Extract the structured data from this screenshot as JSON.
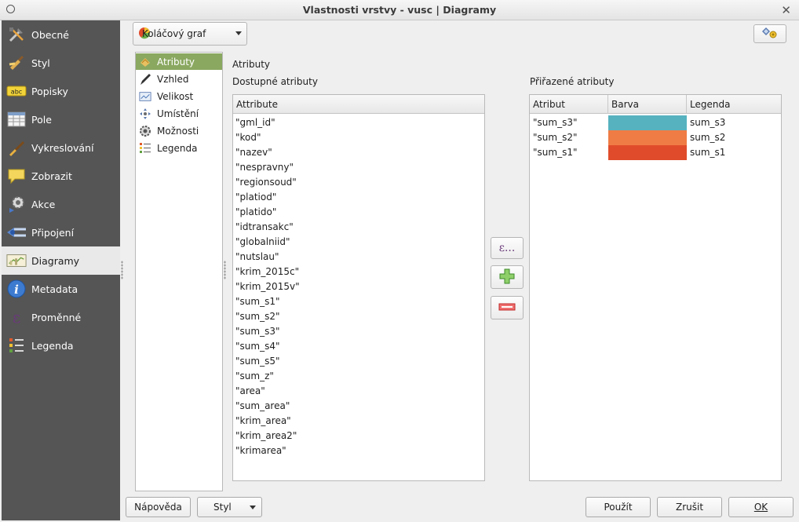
{
  "window": {
    "title": "Vlastnosti vrstvy - vusc | Diagramy"
  },
  "sidebar": {
    "items": [
      {
        "label": "Obecné",
        "icon": "tools-icon"
      },
      {
        "label": "Styl",
        "icon": "paintbrush-icon"
      },
      {
        "label": "Popisky",
        "icon": "abc-label-icon"
      },
      {
        "label": "Pole",
        "icon": "table-icon"
      },
      {
        "label": "Vykreslování",
        "icon": "brush-icon"
      },
      {
        "label": "Zobrazit",
        "icon": "speech-bubble-icon"
      },
      {
        "label": "Akce",
        "icon": "gear-action-icon"
      },
      {
        "label": "Připojení",
        "icon": "join-icon"
      },
      {
        "label": "Diagramy",
        "icon": "diagram-icon"
      },
      {
        "label": "Metadata",
        "icon": "info-icon"
      },
      {
        "label": "Proměnné",
        "icon": "epsilon-icon"
      },
      {
        "label": "Legenda",
        "icon": "legend-icon"
      }
    ],
    "active_index": 8
  },
  "diagram_type": {
    "selected": "Koláčový graf",
    "icon": "pie-chart-icon"
  },
  "subnav": {
    "items": [
      {
        "label": "Atributy",
        "icon": "attributes-icon"
      },
      {
        "label": "Vzhled",
        "icon": "pen-icon"
      },
      {
        "label": "Velikost",
        "icon": "size-icon"
      },
      {
        "label": "Umístění",
        "icon": "placement-icon"
      },
      {
        "label": "Možnosti",
        "icon": "options-icon"
      },
      {
        "label": "Legenda",
        "icon": "legend-icon"
      }
    ],
    "active_index": 0
  },
  "section": {
    "title": "Atributy",
    "available_label": "Dostupné atributy",
    "assigned_label": "Přiřazené atributy"
  },
  "available_table": {
    "header": "Attribute",
    "rows": [
      "\"gml_id\"",
      "\"kod\"",
      "\"nazev\"",
      "\"nespravny\"",
      "\"regionsoud\"",
      "\"platiod\"",
      "\"platido\"",
      "\"idtransakc\"",
      "\"globalniid\"",
      "\"nutslau\"",
      "\"krim_2015c\"",
      "\"krim_2015v\"",
      "\"sum_s1\"",
      "\"sum_s2\"",
      "\"sum_s3\"",
      "\"sum_s4\"",
      "\"sum_s5\"",
      "\"sum_z\"",
      "\"area\"",
      "\"sum_area\"",
      "\"krim_area\"",
      "\"krim_area2\"",
      "\"krimarea\""
    ]
  },
  "assigned_table": {
    "headers": [
      "Atribut",
      "Barva",
      "Legenda"
    ],
    "rows": [
      {
        "attribute": "\"sum_s3\"",
        "color": "#56b2bf",
        "legend": "sum_s3"
      },
      {
        "attribute": "\"sum_s2\"",
        "color": "#f07c45",
        "legend": "sum_s2"
      },
      {
        "attribute": "\"sum_s1\"",
        "color": "#e04c2b",
        "legend": "sum_s1"
      }
    ]
  },
  "middle_buttons": {
    "expression": "ε..."
  },
  "footer": {
    "help": "Nápověda",
    "style": "Styl",
    "apply": "Použít",
    "cancel": "Zrušit",
    "ok": "OK"
  }
}
